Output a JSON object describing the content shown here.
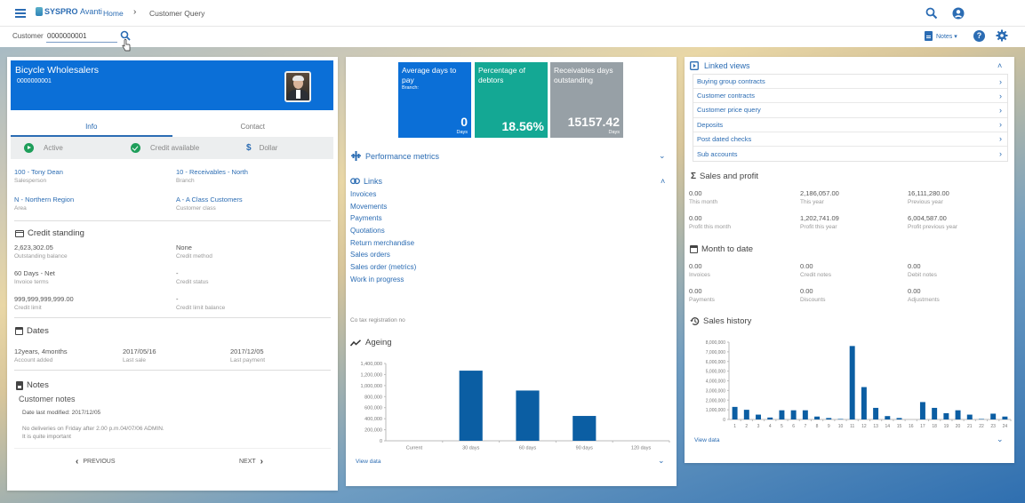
{
  "topbar": {
    "brand": "SYSPRO",
    "brand_suffix": "Avanti",
    "breadcrumb": {
      "home": "Home",
      "separator": "›",
      "current": "Customer Query"
    }
  },
  "subbar": {
    "customer_label": "Customer",
    "customer_value": "0000000001",
    "notes_label": "Notes ▾",
    "help_label": "?"
  },
  "customer": {
    "name": "Bicycle Wholesalers",
    "code": "0000000001",
    "tabs": [
      {
        "label": "Info",
        "active": true
      },
      {
        "label": "Contact",
        "active": false
      }
    ],
    "status": {
      "active": "Active",
      "credit": "Credit available",
      "currency": "Dollar",
      "currency_symbol": "$"
    },
    "info": [
      {
        "value": "100 - Tony Dean",
        "label": "Salesperson"
      },
      {
        "value": "10 - Receivables - North",
        "label": "Branch"
      },
      {
        "value": "N - Northern Region",
        "label": "Area"
      },
      {
        "value": "A - A Class Customers",
        "label": "Customer class"
      }
    ],
    "credit_standing": {
      "title": "Credit standing",
      "fields": [
        {
          "value": "2,623,302.05",
          "label": "Outstanding balance"
        },
        {
          "value": "None",
          "label": "Credit method"
        },
        {
          "value": "60 Days - Net",
          "label": "Invoice terms"
        },
        {
          "value": "-",
          "label": "Credit status"
        },
        {
          "value": "999,999,999,999.00",
          "label": "Credit limit"
        },
        {
          "value": "-",
          "label": "Credit limit balance"
        }
      ]
    },
    "dates": {
      "title": "Dates",
      "fields": [
        {
          "value": "12years, 4months",
          "label": "Account added"
        },
        {
          "value": "2017/05/16",
          "label": "Last sale"
        },
        {
          "value": "2017/12/05",
          "label": "Last payment"
        }
      ]
    },
    "notes": {
      "title": "Notes",
      "subtitle": "Customer notes",
      "date_modified": "Date last modified: 2017/12/05",
      "line1": "No deliveries on Friday after 2.00 p.m.04/07/06 ADMIN.",
      "line2": "It is quite important"
    },
    "pager": {
      "previous": "PREVIOUS",
      "next": "NEXT"
    }
  },
  "kpis": [
    {
      "title": "Average days to pay",
      "subtitle": "Branch:",
      "value": "0",
      "unit": "Days",
      "color": "#0b6fd7"
    },
    {
      "title": "Percentage of debtors",
      "subtitle": "",
      "value": "18.56%",
      "unit": "",
      "color": "#14a894"
    },
    {
      "title": "Receivables days outstanding",
      "subtitle": "",
      "value": "15157.42",
      "unit": "Days",
      "color": "#97a0a6"
    }
  ],
  "middle": {
    "performance_metrics": "Performance metrics",
    "links_title": "Links",
    "links": [
      "Invoices",
      "Movements",
      "Payments",
      "Quotations",
      "Return merchandise",
      "Sales orders",
      "Sales order (metrics)",
      "Work in progress"
    ],
    "tax_reg": "Co tax registration no",
    "ageing_title": "Ageing",
    "view_data": "View data"
  },
  "right": {
    "linked_views_title": "Linked views",
    "linked_views": [
      "Buying group contracts",
      "Customer contracts",
      "Customer price query",
      "Deposits",
      "Post dated checks",
      "Sub accounts"
    ],
    "sales_profit": {
      "title": "Sales and profit",
      "fields": [
        {
          "value": "0.00",
          "label": "This month"
        },
        {
          "value": "2,186,057.00",
          "label": "This year"
        },
        {
          "value": "16,111,280.00",
          "label": "Previous year"
        },
        {
          "value": "0.00",
          "label": "Profit this month"
        },
        {
          "value": "1,202,741.09",
          "label": "Profit this year"
        },
        {
          "value": "6,004,587.00",
          "label": "Profit previous year"
        }
      ]
    },
    "month_to_date": {
      "title": "Month to date",
      "fields": [
        {
          "value": "0.00",
          "label": "Invoices"
        },
        {
          "value": "0.00",
          "label": "Credit notes"
        },
        {
          "value": "0.00",
          "label": "Debit notes"
        },
        {
          "value": "0.00",
          "label": "Payments"
        },
        {
          "value": "0.00",
          "label": "Discounts"
        },
        {
          "value": "0.00",
          "label": "Adjustments"
        }
      ]
    },
    "sales_history_title": "Sales history",
    "view_data": "View data"
  },
  "colors": {
    "accent": "#2b6cb3",
    "bar": "#0b5ea3",
    "header": "#0b6fd7",
    "active_green": "#1e9e5a"
  },
  "chart_data": [
    {
      "type": "bar",
      "title": "Ageing",
      "categories": [
        "Current",
        "30 days",
        "60 days",
        "90 days",
        "120 days"
      ],
      "values": [
        0,
        1270000,
        910000,
        450000,
        0
      ],
      "ylim": [
        0,
        1400000
      ],
      "yticks": [
        0,
        200000,
        400000,
        600000,
        800000,
        1000000,
        1200000,
        1400000
      ],
      "ytick_labels": [
        "0",
        "200,000",
        "400,000",
        "600,000",
        "800,000",
        "1,000,000",
        "1,200,000",
        "1,400,000"
      ],
      "xlabel": "",
      "ylabel": "",
      "grid": false,
      "legend": "none"
    },
    {
      "type": "bar",
      "title": "Sales history",
      "categories": [
        "1",
        "2",
        "3",
        "4",
        "5",
        "6",
        "7",
        "8",
        "9",
        "10",
        "11",
        "12",
        "13",
        "14",
        "15",
        "16",
        "17",
        "18",
        "19",
        "20",
        "21",
        "22",
        "23",
        "24"
      ],
      "values": [
        1300000,
        1000000,
        500000,
        200000,
        950000,
        950000,
        950000,
        300000,
        150000,
        50000,
        7600000,
        3350000,
        1200000,
        350000,
        150000,
        0,
        1800000,
        1200000,
        650000,
        950000,
        500000,
        50000,
        600000,
        300000
      ],
      "ylim": [
        0,
        8000000
      ],
      "yticks": [
        0,
        1000000,
        2000000,
        3000000,
        4000000,
        5000000,
        6000000,
        7000000,
        8000000
      ],
      "ytick_labels": [
        "0",
        "1,000,000",
        "2,000,000",
        "3,000,000",
        "4,000,000",
        "5,000,000",
        "6,000,000",
        "7,000,000",
        "8,000,000"
      ],
      "xlabel": "",
      "ylabel": "",
      "grid": false,
      "legend": "none"
    }
  ]
}
